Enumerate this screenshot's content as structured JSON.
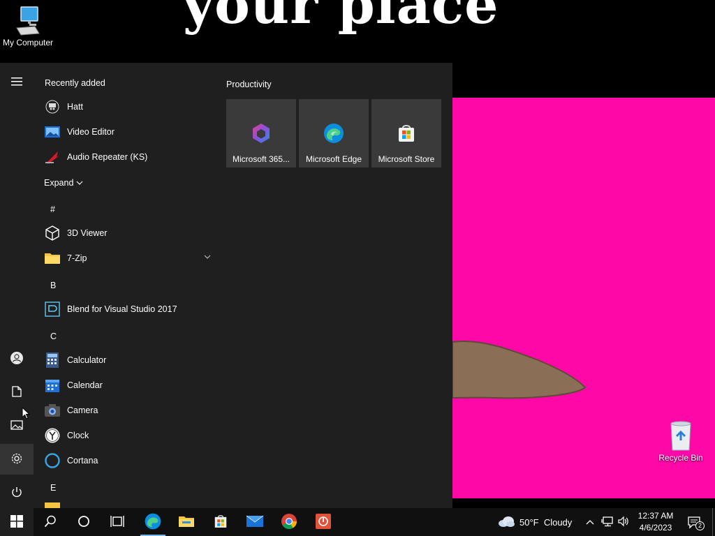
{
  "wallpaper": {
    "title_text": "your place"
  },
  "desktop": {
    "my_computer_label": "My Computer",
    "recycle_bin_label": "Recycle Bin"
  },
  "start_menu": {
    "recently_added_heading": "Recently added",
    "recent_apps": [
      {
        "label": "Hatt",
        "icon": "hatt-icon"
      },
      {
        "label": "Video Editor",
        "icon": "video-editor-icon"
      },
      {
        "label": "Audio Repeater (KS)",
        "icon": "audio-repeater-icon"
      }
    ],
    "expand_label": "Expand",
    "letters": [
      "#",
      "B",
      "C",
      "E"
    ],
    "apps": [
      {
        "label": "3D Viewer",
        "icon": "cube-icon"
      },
      {
        "label": "7-Zip",
        "icon": "folder-icon"
      },
      {
        "label": "Blend for Visual Studio 2017",
        "icon": "blend-icon"
      },
      {
        "label": "Calculator",
        "icon": "calculator-icon"
      },
      {
        "label": "Calendar",
        "icon": "calendar-icon"
      },
      {
        "label": "Camera",
        "icon": "camera-icon"
      },
      {
        "label": "Clock",
        "icon": "clock-icon"
      },
      {
        "label": "Cortana",
        "icon": "cortana-icon"
      }
    ],
    "tiles_heading": "Productivity",
    "tiles": [
      {
        "label": "Microsoft 365...",
        "icon": "microsoft-365-icon"
      },
      {
        "label": "Microsoft Edge",
        "icon": "edge-icon"
      },
      {
        "label": "Microsoft Store",
        "icon": "store-icon"
      }
    ],
    "rail": [
      "hamburger-icon",
      "user-icon",
      "documents-icon",
      "pictures-icon",
      "settings-icon",
      "power-icon"
    ]
  },
  "taskbar": {
    "pinned": [
      "windows-start-icon",
      "search-icon",
      "cortana-icon",
      "task-view-icon",
      "edge-icon",
      "file-explorer-icon",
      "store-icon",
      "mail-icon",
      "chrome-icon",
      "app-red-icon"
    ],
    "weather_text": "50°F  Cloudy",
    "time": "12:37 AM",
    "date": "4/6/2023",
    "notification_count": "2"
  },
  "colors": {
    "accent_pink": "#ff08a8",
    "start_bg": "#1f1f1f",
    "tile_bg": "#3a3a3a",
    "taskbar_bg": "#101010",
    "edge_blue": "#0c8ee0"
  }
}
